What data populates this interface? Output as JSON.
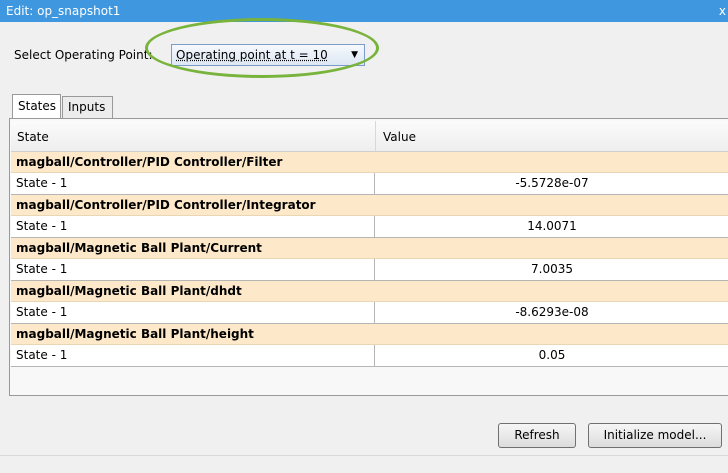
{
  "window": {
    "title": "Edit: op_snapshot1",
    "close_glyph": "x"
  },
  "operating_point": {
    "label": "Select Operating Point:",
    "selected": "Operating point at t = 10",
    "arrow": "▼"
  },
  "tabs": [
    {
      "label": "States",
      "active": true
    },
    {
      "label": "Inputs",
      "active": false
    }
  ],
  "table": {
    "columns": [
      "State",
      "Value"
    ],
    "groups": [
      {
        "name": "magball/Controller/PID Controller/Filter",
        "state": "State - 1",
        "value": "-5.5728e-07"
      },
      {
        "name": "magball/Controller/PID Controller/Integrator",
        "state": "State - 1",
        "value": "14.0071"
      },
      {
        "name": "magball/Magnetic Ball Plant/Current",
        "state": "State - 1",
        "value": "7.0035"
      },
      {
        "name": "magball/Magnetic Ball Plant/dhdt",
        "state": "State - 1",
        "value": "-8.6293e-08"
      },
      {
        "name": "magball/Magnetic Ball Plant/height",
        "state": "State - 1",
        "value": "0.05"
      }
    ]
  },
  "buttons": {
    "refresh": "Refresh",
    "initialize": "Initialize model..."
  },
  "colors": {
    "title_bar": "#3f97df",
    "group_row": "#fde9c9",
    "highlight": "#78b33b"
  }
}
